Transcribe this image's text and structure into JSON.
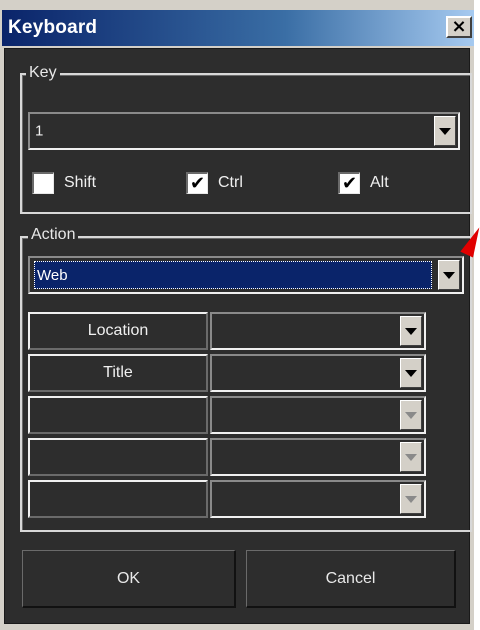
{
  "window": {
    "title": "Keyboard",
    "close_glyph": "×"
  },
  "key_group": {
    "legend": "Key",
    "key_value": "1",
    "modifiers": [
      {
        "label": "Shift",
        "checked": false
      },
      {
        "label": "Ctrl",
        "checked": true
      },
      {
        "label": "Alt",
        "checked": true
      }
    ]
  },
  "action_group": {
    "legend": "Action",
    "action_value": "Web",
    "rows": [
      {
        "label": "Location",
        "value": "",
        "enabled": true
      },
      {
        "label": "Title",
        "value": "",
        "enabled": true
      },
      {
        "label": "",
        "value": "",
        "enabled": false
      },
      {
        "label": "",
        "value": "",
        "enabled": false
      },
      {
        "label": "",
        "value": "",
        "enabled": false
      }
    ]
  },
  "buttons": {
    "ok": "OK",
    "cancel": "Cancel"
  },
  "colors": {
    "client_bg": "#2d2d2d",
    "selection": "#0a246a",
    "title_gradient_start": "#0a246a",
    "marker": "#e00000"
  }
}
